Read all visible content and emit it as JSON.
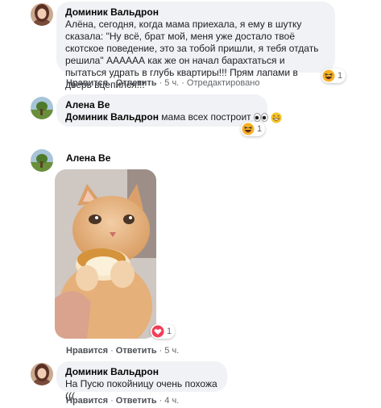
{
  "comments": [
    {
      "author": "Доминик Вальдрон",
      "text": "Алёна, сегодня, когда мама приехала, я ему в шутку сказала: \"Ну всё, брат мой, меня уже достало твоё скотское поведение, это за тобой пришли, я тебя отдать решила\" АААААА как же он начал барахтаться и пытаться удрать в глубь квартиры!!! Прям лапами в дверь вцепился!!!",
      "like_label": "Нравится",
      "reply_label": "Ответить",
      "time": "5 ч.",
      "edited": "Отредактировано",
      "reaction_count": "1",
      "reaction_icon": "laugh-emoji"
    },
    {
      "author": "Алена Ве",
      "mention": "Доминик Вальдрон",
      "text": "мама всех построит",
      "reaction_count": "1",
      "reaction_icon": "laugh-emoji"
    },
    {
      "author": "Алена Ве",
      "photo": "cat-eating-bread",
      "like_label": "Нравится",
      "reply_label": "Ответить",
      "time": "5 ч.",
      "reaction_count": "1",
      "reaction_icon": "love-heart"
    },
    {
      "author": "Доминик Вальдрон",
      "text": "На Пусю покойницу очень похожа (((",
      "like_label": "Нравится",
      "reply_label": "Ответить",
      "time": "4 ч."
    }
  ],
  "colors": {
    "bubble": "#f0f2f5",
    "meta": "#65676b",
    "love": "#f33e58",
    "haha": "#f7b125"
  }
}
